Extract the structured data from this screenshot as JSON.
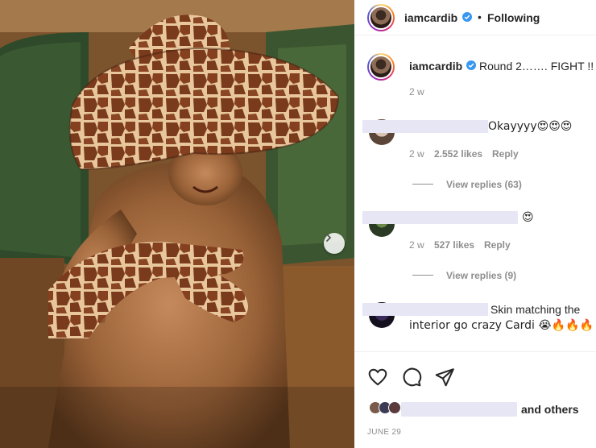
{
  "post": {
    "username": "iamcardib",
    "follow_label": "Following",
    "separator": "•"
  },
  "caption": {
    "username": "iamcardib",
    "text": "Round 2……. FIGHT !!",
    "age": "2 w"
  },
  "comments": [
    {
      "text": "Okayyyy😍😍😍",
      "age": "2 w",
      "likes": "2.552 likes",
      "reply_label": "Reply",
      "view_replies": "View replies (63)"
    },
    {
      "text": "😍",
      "age": "2 w",
      "likes": "527 likes",
      "reply_label": "Reply",
      "view_replies": "View replies (9)"
    },
    {
      "text_line1": "Skin matching the",
      "text_line2": "interior go crazy Cardi 😭🔥🔥🔥"
    }
  ],
  "likes_text": "and others",
  "post_date": "JUNE 29",
  "icons": {
    "like": "heart-icon",
    "comment": "comment-icon",
    "share": "share-icon",
    "next": "chevron-right-icon",
    "verified": "verified-badge-icon"
  },
  "colors": {
    "verified": "#3897f0",
    "text": "#262626",
    "muted": "#8e8e8e",
    "redaction": "#e6e6f5"
  }
}
